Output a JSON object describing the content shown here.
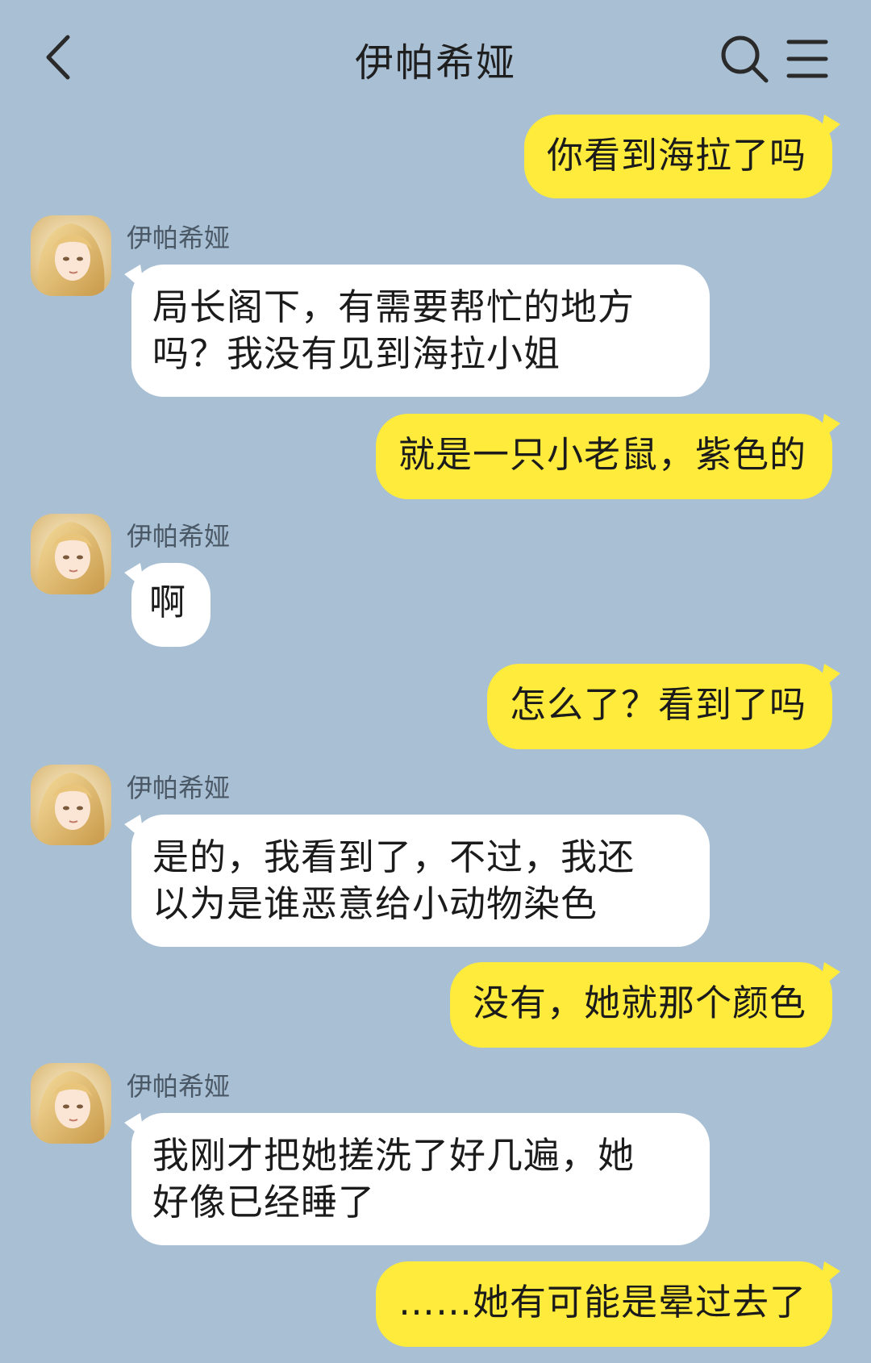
{
  "header": {
    "title": "伊帕希娅",
    "back_icon": "chevron-left-icon",
    "search_icon": "search-icon",
    "menu_icon": "menu-icon"
  },
  "colors": {
    "background": "#a9bfd4",
    "outgoing_bubble": "#ffeb3b",
    "incoming_bubble": "#ffffff"
  },
  "messages": [
    {
      "direction": "out",
      "text": "你看到海拉了吗"
    },
    {
      "direction": "in",
      "sender": "伊帕希娅",
      "lines": [
        "局长阁下，有需要帮忙的地方",
        "吗？我没有见到海拉小姐"
      ]
    },
    {
      "direction": "out",
      "text": "就是一只小老鼠，紫色的"
    },
    {
      "direction": "in",
      "sender": "伊帕希娅",
      "lines": [
        "啊"
      ]
    },
    {
      "direction": "out",
      "text": "怎么了？看到了吗"
    },
    {
      "direction": "in",
      "sender": "伊帕希娅",
      "lines": [
        "是的，我看到了，不过，我还",
        "以为是谁恶意给小动物染色"
      ]
    },
    {
      "direction": "out",
      "text": "没有，她就那个颜色"
    },
    {
      "direction": "in",
      "sender": "伊帕希娅",
      "lines": [
        "我刚才把她搓洗了好几遍，她",
        "好像已经睡了"
      ]
    },
    {
      "direction": "out",
      "text": "……她有可能是晕过去了"
    }
  ]
}
